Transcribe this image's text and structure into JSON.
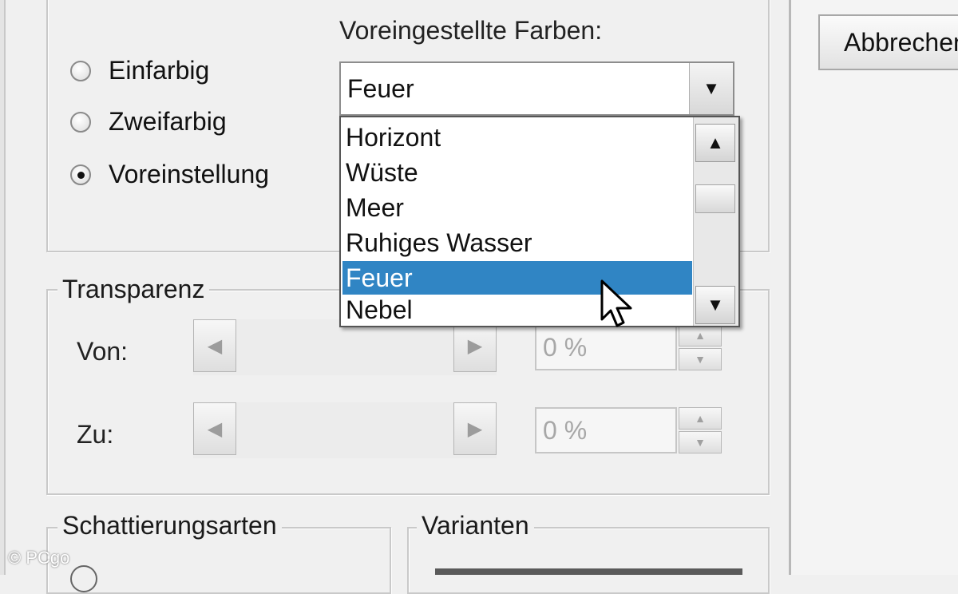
{
  "combo": {
    "label": "Voreingestellte Farben:",
    "value": "Feuer"
  },
  "radios": [
    {
      "label": "Einfarbig",
      "checked": false
    },
    {
      "label": "Zweifarbig",
      "checked": false
    },
    {
      "label": "Voreinstellung",
      "checked": true
    }
  ],
  "list": {
    "items": [
      "Horizont",
      "Wüste",
      "Meer",
      "Ruhiges Wasser",
      "Feuer",
      "Nebel"
    ],
    "selected": "Feuer"
  },
  "transparency": {
    "title": "Transparenz",
    "from_label": "Von:",
    "to_label": "Zu:",
    "from_value": "0 %",
    "to_value": "0 %"
  },
  "shading": {
    "title": "Schattierungsarten"
  },
  "variants": {
    "title": "Varianten"
  },
  "buttons": {
    "cancel": "Abbrechen"
  },
  "watermark": "© PCgo",
  "colors": {
    "selection": "#3085c4",
    "background": "#f0f0f0"
  }
}
